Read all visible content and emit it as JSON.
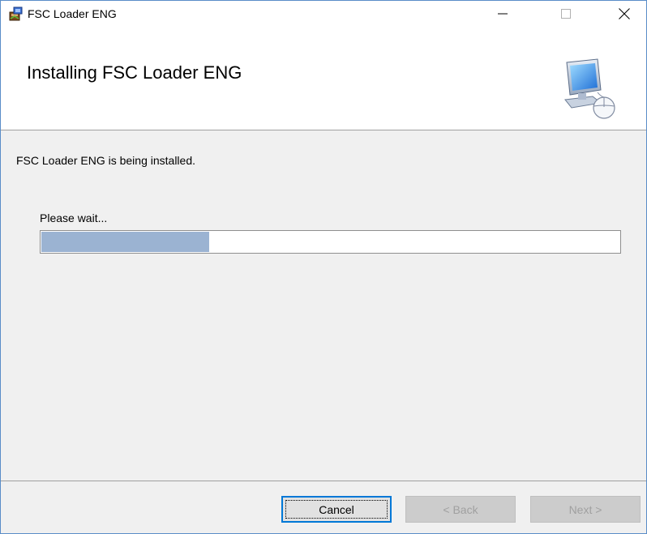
{
  "window": {
    "title": "FSC Loader ENG",
    "controls": {
      "minimize": "—",
      "maximize": "☐",
      "close": "✕"
    }
  },
  "banner": {
    "title": "Installing FSC Loader ENG",
    "icon": "computer-install-icon"
  },
  "body": {
    "status": "FSC Loader ENG is being installed.",
    "wait_label": "Please wait...",
    "progress_fraction": 0.29
  },
  "footer": {
    "cancel_label": "Cancel",
    "back_label": "< Back",
    "next_label": "Next >"
  },
  "colors": {
    "progress_fill": "#9bb3d2",
    "focus_border": "#0078d7"
  }
}
